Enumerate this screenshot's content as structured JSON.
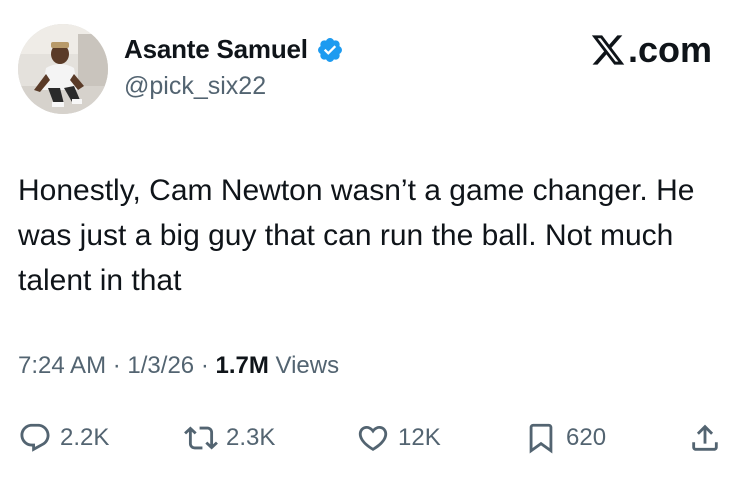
{
  "author": {
    "display_name": "Asante Samuel",
    "handle": "@pick_six22",
    "verified_icon": "verified-badge-icon",
    "avatar": "profile-photo"
  },
  "brand": {
    "logo_icon": "x-logo-icon",
    "text": ".com"
  },
  "tweet": {
    "text": "Honestly, Cam Newton wasn’t a game changer. He was just a big guy that can run the ball. Not much talent in that"
  },
  "meta": {
    "time": "7:24 AM",
    "sep1": "·",
    "date": "1/3/26",
    "sep2": "·",
    "views_count": "1.7M",
    "views_label": "Views"
  },
  "actions": {
    "replies": {
      "icon": "reply-icon",
      "count": "2.2K"
    },
    "reposts": {
      "icon": "repost-icon",
      "count": "2.3K"
    },
    "likes": {
      "icon": "heart-icon",
      "count": "12K"
    },
    "bookmarks": {
      "icon": "bookmark-icon",
      "count": "620"
    },
    "share": {
      "icon": "share-icon"
    }
  },
  "colors": {
    "text_primary": "#0f1419",
    "text_secondary": "#536471",
    "verified_blue": "#1d9bf0",
    "background": "#ffffff"
  }
}
